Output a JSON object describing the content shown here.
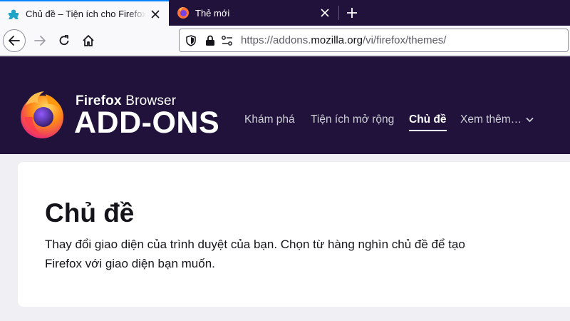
{
  "tabs": [
    {
      "title": "Chủ đề – Tiện ích cho Firefox (vi)",
      "icon": "puzzle-icon",
      "active": true
    },
    {
      "title": "Thẻ mới",
      "icon": "firefox-icon",
      "active": false
    }
  ],
  "toolbar": {
    "url_prefix": "https://addons.",
    "url_domain": "mozilla.org",
    "url_path": "/vi/firefox/themes/"
  },
  "header": {
    "brand_top_bold": "Firefox",
    "brand_top_rest": " Browser",
    "brand_main": "ADD-ONS",
    "nav": [
      {
        "label": "Khám phá",
        "active": false
      },
      {
        "label": "Tiện ích mở rộng",
        "active": false
      },
      {
        "label": "Chủ đề",
        "active": true
      },
      {
        "label": "Xem thêm…",
        "active": false
      }
    ]
  },
  "main": {
    "title": "Chủ đề",
    "description": "Thay đổi giao diện của trình duyệt của bạn. Chọn từ hàng nghìn chủ đề để tạo Firefox với giao diện bạn muốn."
  },
  "colors": {
    "header_bg": "#20123a",
    "accent_tab": "#0a84ff",
    "page_bg": "#f0f0f4"
  }
}
